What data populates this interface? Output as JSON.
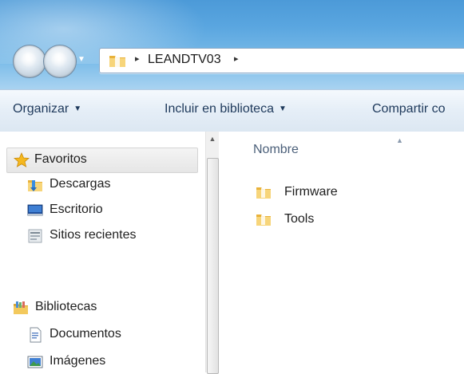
{
  "address": {
    "path": "LEANDTV03",
    "separator": "▸"
  },
  "toolbar": {
    "organize": "Organizar",
    "include_library": "Incluir en biblioteca",
    "share": "Compartir co",
    "caret": "▼"
  },
  "sidebar": {
    "favorites": "Favoritos",
    "downloads": "Descargas",
    "desktop": "Escritorio",
    "recent": "Sitios recientes",
    "libraries": "Bibliotecas",
    "documents": "Documentos",
    "images": "Imágenes"
  },
  "content": {
    "column_name": "Nombre",
    "items": [
      {
        "name": "Firmware",
        "type": "folder"
      },
      {
        "name": "Tools",
        "type": "folder"
      }
    ]
  },
  "colors": {
    "title_blue": "#5aa6e0",
    "command_text": "#1e395b",
    "folder_yellow": "#f2c144"
  }
}
